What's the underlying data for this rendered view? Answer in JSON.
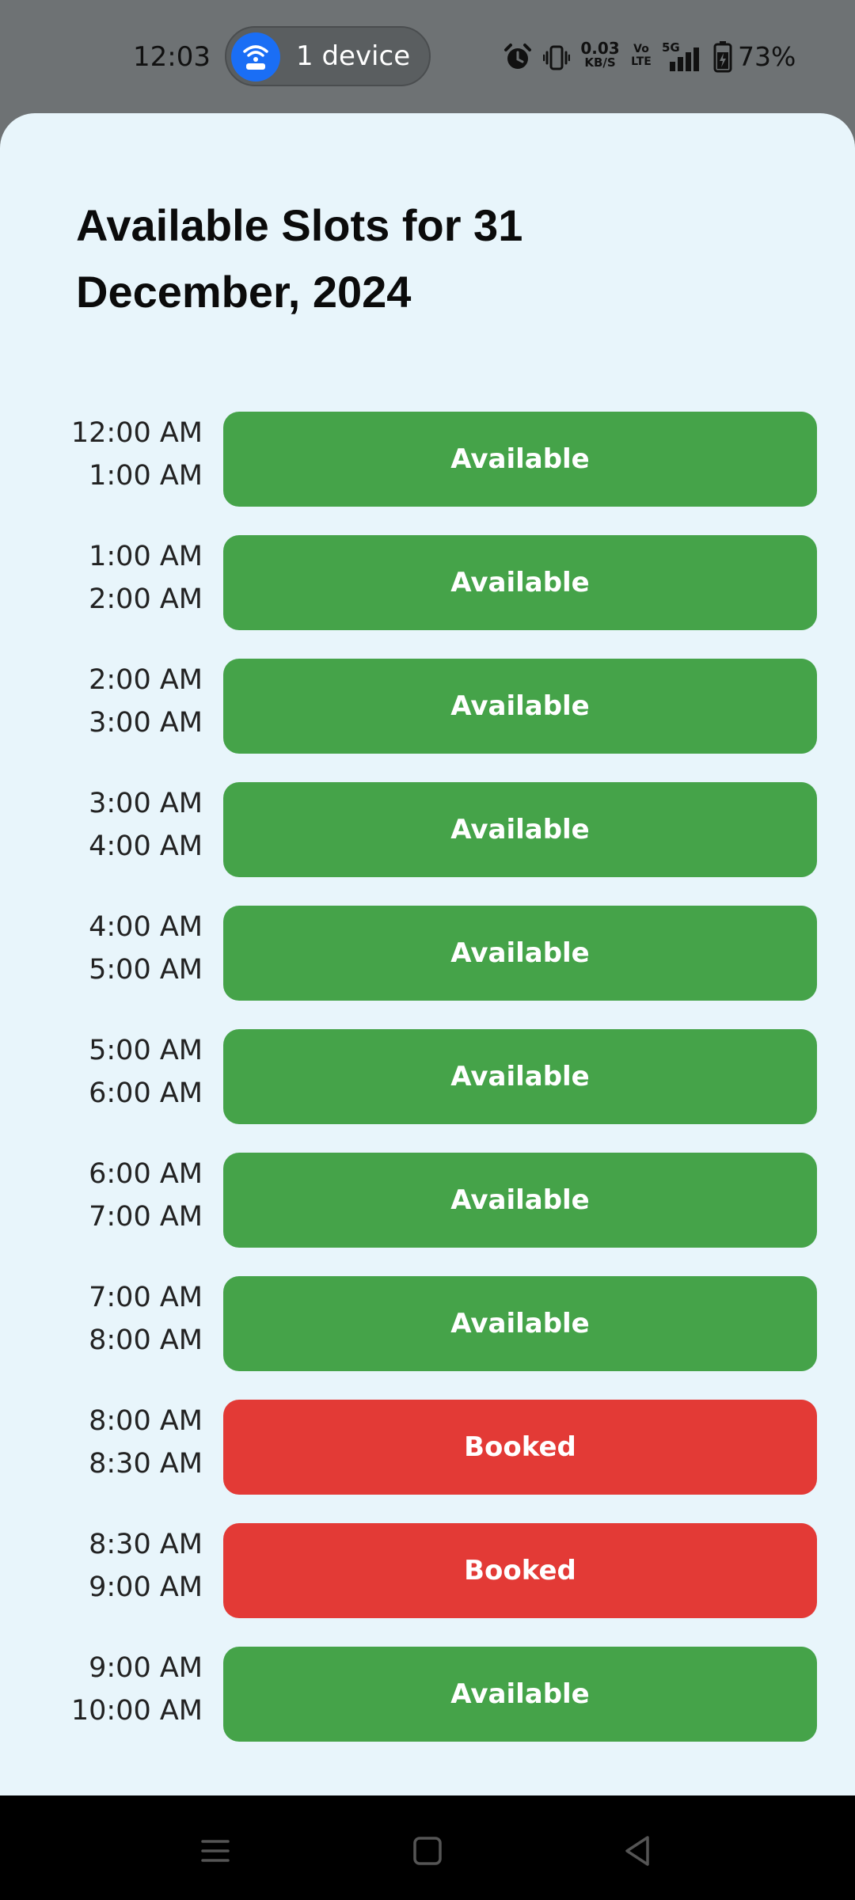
{
  "status_bar": {
    "time": "12:03",
    "hotspot_label": "1 device",
    "net_speed_value": "0.03",
    "net_speed_unit": "KB/S",
    "volte_top": "Vo",
    "volte_bottom": "LTE",
    "network_type": "5G",
    "battery_percent": "73%"
  },
  "page": {
    "title": "Available Slots for 31 December, 2024"
  },
  "colors": {
    "available": "#45a349",
    "booked": "#e33a36",
    "background": "#e8f5fb"
  },
  "slots": [
    {
      "start": "12:00 AM",
      "end": "1:00 AM",
      "status": "Available"
    },
    {
      "start": "1:00 AM",
      "end": "2:00 AM",
      "status": "Available"
    },
    {
      "start": "2:00 AM",
      "end": "3:00 AM",
      "status": "Available"
    },
    {
      "start": "3:00 AM",
      "end": "4:00 AM",
      "status": "Available"
    },
    {
      "start": "4:00 AM",
      "end": "5:00 AM",
      "status": "Available"
    },
    {
      "start": "5:00 AM",
      "end": "6:00 AM",
      "status": "Available"
    },
    {
      "start": "6:00 AM",
      "end": "7:00 AM",
      "status": "Available"
    },
    {
      "start": "7:00 AM",
      "end": "8:00 AM",
      "status": "Available"
    },
    {
      "start": "8:00 AM",
      "end": "8:30 AM",
      "status": "Booked"
    },
    {
      "start": "8:30 AM",
      "end": "9:00 AM",
      "status": "Booked"
    },
    {
      "start": "9:00 AM",
      "end": "10:00 AM",
      "status": "Available"
    }
  ],
  "nav_bar": {
    "icons": [
      "menu-icon",
      "home-icon",
      "back-icon"
    ]
  }
}
